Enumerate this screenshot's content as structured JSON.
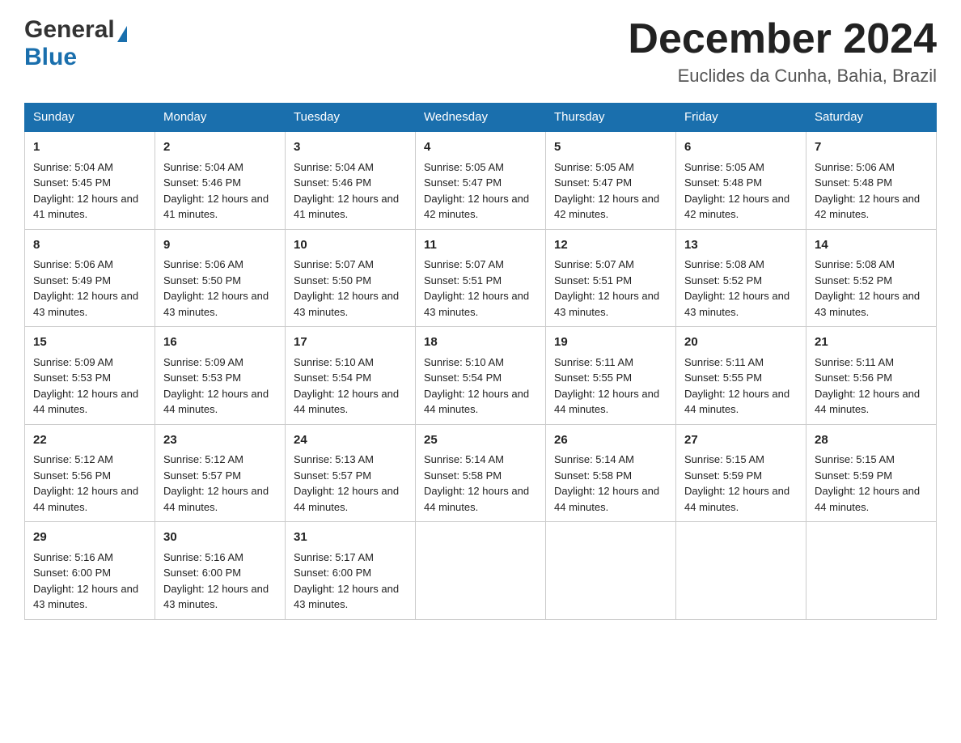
{
  "header": {
    "logo_general": "General",
    "logo_blue": "Blue",
    "month_title": "December 2024",
    "location": "Euclides da Cunha, Bahia, Brazil"
  },
  "days_of_week": [
    "Sunday",
    "Monday",
    "Tuesday",
    "Wednesday",
    "Thursday",
    "Friday",
    "Saturday"
  ],
  "weeks": [
    [
      {
        "day": "1",
        "sunrise": "Sunrise: 5:04 AM",
        "sunset": "Sunset: 5:45 PM",
        "daylight": "Daylight: 12 hours and 41 minutes."
      },
      {
        "day": "2",
        "sunrise": "Sunrise: 5:04 AM",
        "sunset": "Sunset: 5:46 PM",
        "daylight": "Daylight: 12 hours and 41 minutes."
      },
      {
        "day": "3",
        "sunrise": "Sunrise: 5:04 AM",
        "sunset": "Sunset: 5:46 PM",
        "daylight": "Daylight: 12 hours and 41 minutes."
      },
      {
        "day": "4",
        "sunrise": "Sunrise: 5:05 AM",
        "sunset": "Sunset: 5:47 PM",
        "daylight": "Daylight: 12 hours and 42 minutes."
      },
      {
        "day": "5",
        "sunrise": "Sunrise: 5:05 AM",
        "sunset": "Sunset: 5:47 PM",
        "daylight": "Daylight: 12 hours and 42 minutes."
      },
      {
        "day": "6",
        "sunrise": "Sunrise: 5:05 AM",
        "sunset": "Sunset: 5:48 PM",
        "daylight": "Daylight: 12 hours and 42 minutes."
      },
      {
        "day": "7",
        "sunrise": "Sunrise: 5:06 AM",
        "sunset": "Sunset: 5:48 PM",
        "daylight": "Daylight: 12 hours and 42 minutes."
      }
    ],
    [
      {
        "day": "8",
        "sunrise": "Sunrise: 5:06 AM",
        "sunset": "Sunset: 5:49 PM",
        "daylight": "Daylight: 12 hours and 43 minutes."
      },
      {
        "day": "9",
        "sunrise": "Sunrise: 5:06 AM",
        "sunset": "Sunset: 5:50 PM",
        "daylight": "Daylight: 12 hours and 43 minutes."
      },
      {
        "day": "10",
        "sunrise": "Sunrise: 5:07 AM",
        "sunset": "Sunset: 5:50 PM",
        "daylight": "Daylight: 12 hours and 43 minutes."
      },
      {
        "day": "11",
        "sunrise": "Sunrise: 5:07 AM",
        "sunset": "Sunset: 5:51 PM",
        "daylight": "Daylight: 12 hours and 43 minutes."
      },
      {
        "day": "12",
        "sunrise": "Sunrise: 5:07 AM",
        "sunset": "Sunset: 5:51 PM",
        "daylight": "Daylight: 12 hours and 43 minutes."
      },
      {
        "day": "13",
        "sunrise": "Sunrise: 5:08 AM",
        "sunset": "Sunset: 5:52 PM",
        "daylight": "Daylight: 12 hours and 43 minutes."
      },
      {
        "day": "14",
        "sunrise": "Sunrise: 5:08 AM",
        "sunset": "Sunset: 5:52 PM",
        "daylight": "Daylight: 12 hours and 43 minutes."
      }
    ],
    [
      {
        "day": "15",
        "sunrise": "Sunrise: 5:09 AM",
        "sunset": "Sunset: 5:53 PM",
        "daylight": "Daylight: 12 hours and 44 minutes."
      },
      {
        "day": "16",
        "sunrise": "Sunrise: 5:09 AM",
        "sunset": "Sunset: 5:53 PM",
        "daylight": "Daylight: 12 hours and 44 minutes."
      },
      {
        "day": "17",
        "sunrise": "Sunrise: 5:10 AM",
        "sunset": "Sunset: 5:54 PM",
        "daylight": "Daylight: 12 hours and 44 minutes."
      },
      {
        "day": "18",
        "sunrise": "Sunrise: 5:10 AM",
        "sunset": "Sunset: 5:54 PM",
        "daylight": "Daylight: 12 hours and 44 minutes."
      },
      {
        "day": "19",
        "sunrise": "Sunrise: 5:11 AM",
        "sunset": "Sunset: 5:55 PM",
        "daylight": "Daylight: 12 hours and 44 minutes."
      },
      {
        "day": "20",
        "sunrise": "Sunrise: 5:11 AM",
        "sunset": "Sunset: 5:55 PM",
        "daylight": "Daylight: 12 hours and 44 minutes."
      },
      {
        "day": "21",
        "sunrise": "Sunrise: 5:11 AM",
        "sunset": "Sunset: 5:56 PM",
        "daylight": "Daylight: 12 hours and 44 minutes."
      }
    ],
    [
      {
        "day": "22",
        "sunrise": "Sunrise: 5:12 AM",
        "sunset": "Sunset: 5:56 PM",
        "daylight": "Daylight: 12 hours and 44 minutes."
      },
      {
        "day": "23",
        "sunrise": "Sunrise: 5:12 AM",
        "sunset": "Sunset: 5:57 PM",
        "daylight": "Daylight: 12 hours and 44 minutes."
      },
      {
        "day": "24",
        "sunrise": "Sunrise: 5:13 AM",
        "sunset": "Sunset: 5:57 PM",
        "daylight": "Daylight: 12 hours and 44 minutes."
      },
      {
        "day": "25",
        "sunrise": "Sunrise: 5:14 AM",
        "sunset": "Sunset: 5:58 PM",
        "daylight": "Daylight: 12 hours and 44 minutes."
      },
      {
        "day": "26",
        "sunrise": "Sunrise: 5:14 AM",
        "sunset": "Sunset: 5:58 PM",
        "daylight": "Daylight: 12 hours and 44 minutes."
      },
      {
        "day": "27",
        "sunrise": "Sunrise: 5:15 AM",
        "sunset": "Sunset: 5:59 PM",
        "daylight": "Daylight: 12 hours and 44 minutes."
      },
      {
        "day": "28",
        "sunrise": "Sunrise: 5:15 AM",
        "sunset": "Sunset: 5:59 PM",
        "daylight": "Daylight: 12 hours and 44 minutes."
      }
    ],
    [
      {
        "day": "29",
        "sunrise": "Sunrise: 5:16 AM",
        "sunset": "Sunset: 6:00 PM",
        "daylight": "Daylight: 12 hours and 43 minutes."
      },
      {
        "day": "30",
        "sunrise": "Sunrise: 5:16 AM",
        "sunset": "Sunset: 6:00 PM",
        "daylight": "Daylight: 12 hours and 43 minutes."
      },
      {
        "day": "31",
        "sunrise": "Sunrise: 5:17 AM",
        "sunset": "Sunset: 6:00 PM",
        "daylight": "Daylight: 12 hours and 43 minutes."
      },
      null,
      null,
      null,
      null
    ]
  ]
}
